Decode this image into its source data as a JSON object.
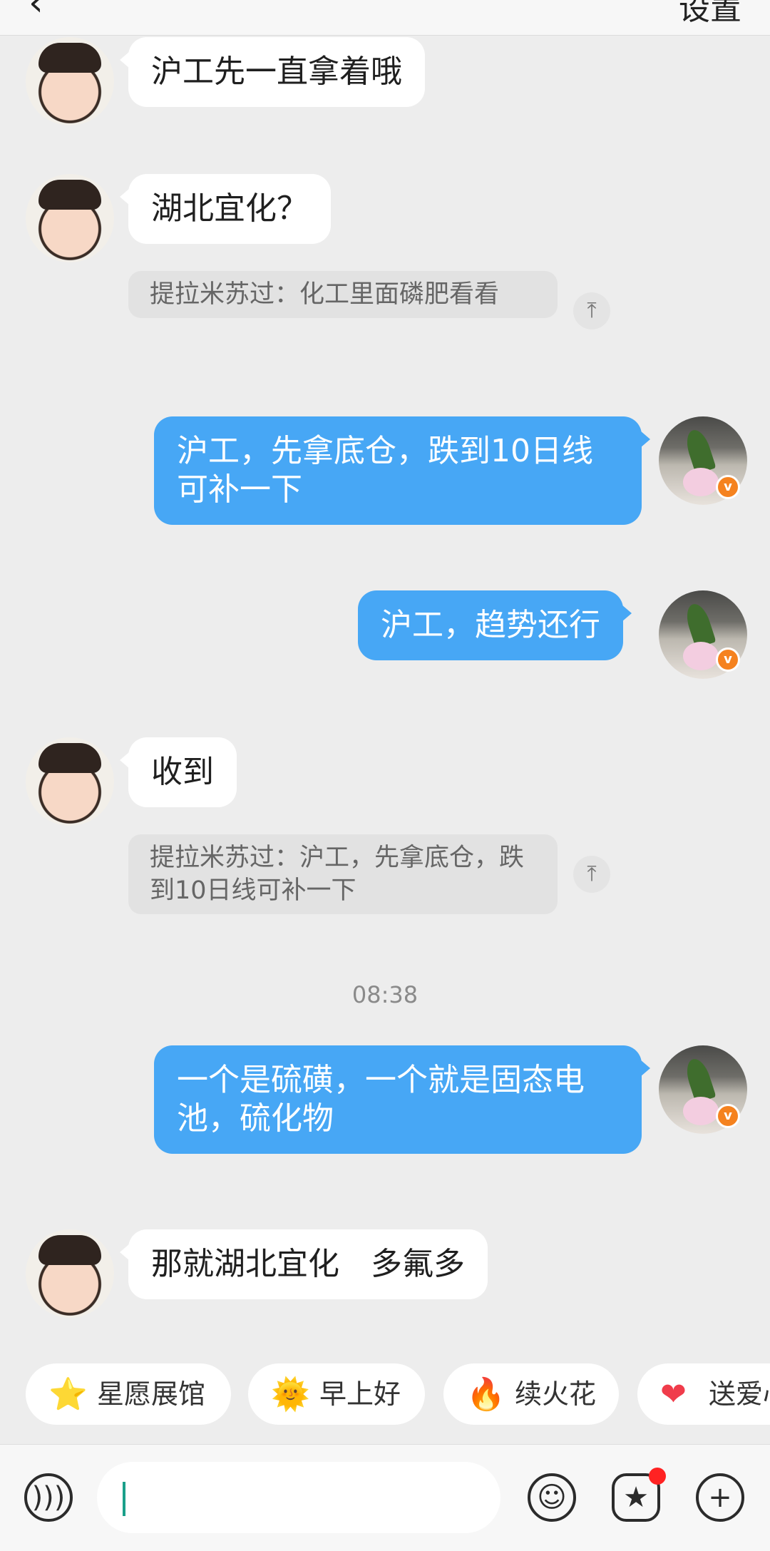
{
  "header": {
    "back_icon": "‹",
    "title": "",
    "settings_label": "设置"
  },
  "messages": [
    {
      "side": "left",
      "text": "沪工先一直拿着哦"
    },
    {
      "side": "left",
      "text": "湖北宜化？",
      "quote": "提拉米苏过：化工里面磷肥看看"
    },
    {
      "side": "right",
      "text": "沪工，先拿底仓，跌到10日线可补一下"
    },
    {
      "side": "right",
      "text": "沪工，趋势还行"
    },
    {
      "side": "left",
      "text": "收到",
      "quote": "提拉米苏过：沪工，先拿底仓，跌到10日线可补一下"
    },
    {
      "side": "right",
      "text": "一个是硫磺，一个就是固态电池，硫化物"
    },
    {
      "side": "left",
      "text": "那就湖北宜化　多氟多"
    }
  ],
  "timestamp": "08:38",
  "quick_replies": [
    {
      "icon": "star-icon",
      "glyph": "⭐",
      "label": "星愿展馆"
    },
    {
      "icon": "sun-face-icon",
      "glyph": "🌞",
      "label": "早上好"
    },
    {
      "icon": "fire-icon",
      "glyph": "🔥",
      "label": "续火花"
    },
    {
      "icon": "heart-icon",
      "glyph": "❤",
      "label": "送爱心"
    }
  ],
  "input": {
    "placeholder": ""
  },
  "colors": {
    "background": "#ededed",
    "bubble_left": "#ffffff",
    "bubble_right": "#47a7f5",
    "quote_bg": "#e2e2e2",
    "badge": "#f5821f"
  }
}
